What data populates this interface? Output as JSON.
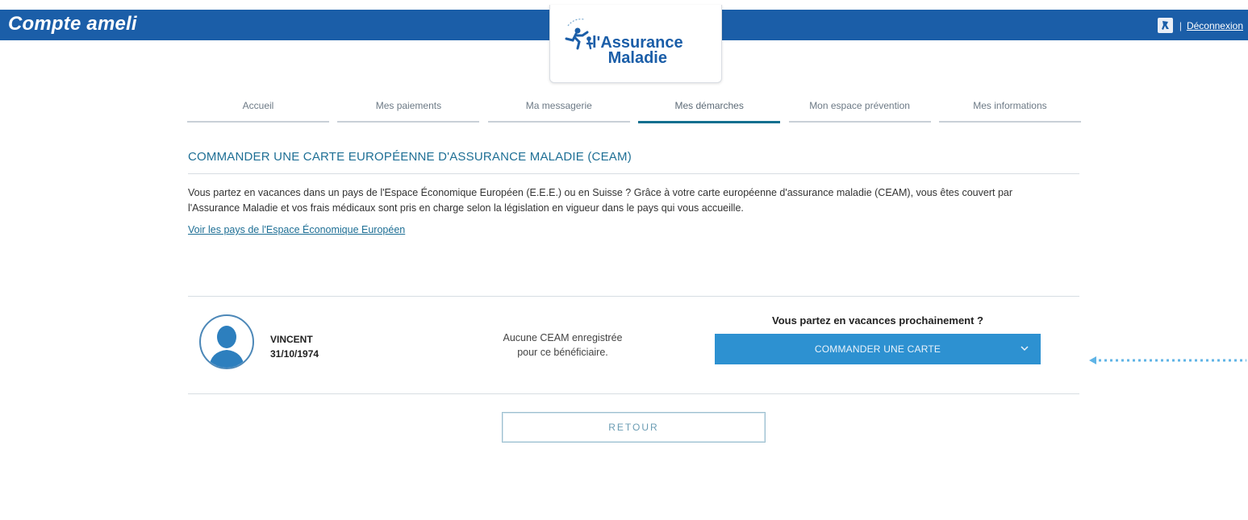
{
  "header": {
    "app_title": "Compte ameli",
    "separator": "|",
    "logout_label": "Déconnexion",
    "accessibility_icon": "accessibility-icon",
    "color": "#1b5ea8"
  },
  "logo": {
    "line1": "l'Assurance",
    "line2": "Maladie",
    "icon": "assurance-maladie-runner-logo"
  },
  "nav": {
    "items": [
      {
        "label": "Accueil",
        "active": false
      },
      {
        "label": "Mes paiements",
        "active": false
      },
      {
        "label": "Ma messagerie",
        "active": false
      },
      {
        "label": "Mes démarches",
        "active": true
      },
      {
        "label": "Mon espace prévention",
        "active": false
      },
      {
        "label": "Mes informations",
        "active": false
      }
    ]
  },
  "page": {
    "title": "COMMANDER UNE CARTE EUROPÉENNE D'ASSURANCE MALADIE (CEAM)",
    "intro": "Vous partez en vacances dans un pays de l'Espace Économique Européen (E.E.E.) ou en Suisse ? Grâce à votre carte européenne d'assurance maladie (CEAM), vous êtes couvert par l'Assurance Maladie et vos frais médicaux sont pris en charge selon la législation en vigueur dans le pays qui vous accueille.",
    "eee_link": "Voir les pays de l'Espace Économique Européen"
  },
  "beneficiary": {
    "name": "VINCENT",
    "birthdate": "31/10/1974",
    "avatar_icon": "person-avatar-icon",
    "status_line1": "Aucune CEAM enregistrée",
    "status_line2": "pour ce bénéficiaire."
  },
  "order": {
    "question": "Vous partez en vacances prochainement ?",
    "button_label": "COMMANDER UNE CARTE",
    "button_color": "#2d91d1"
  },
  "back_button_label": "RETOUR",
  "annotation_color": "#5fb4e6"
}
